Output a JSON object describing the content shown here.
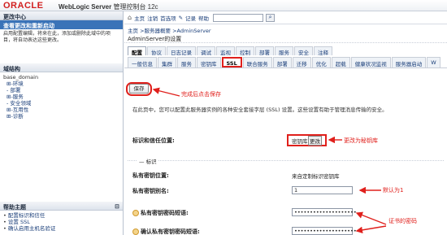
{
  "header": {
    "brand": "ORACLE",
    "product_bold": "WebLogic Server",
    "product_rest": " 管理控制台 12c"
  },
  "change_center": {
    "title": "更改中心",
    "link": "查看更改和重新启动",
    "description": "启用配置编辑，将来在此，添加或删除此域中的项目，将自动表达这些更改。"
  },
  "domain_structure": {
    "title": "域结构",
    "root": "base_domain",
    "items": [
      "⊞-环境",
      "- 部署",
      "⊞-服务",
      "- 安全领域",
      "⊞-互用性",
      "⊞-诊断"
    ]
  },
  "help_topics": {
    "title": "帮助主题",
    "items": [
      "配置标识和信任",
      "设置 SSL",
      "确认启用主机名验证"
    ]
  },
  "toolbar": {
    "items": [
      "主页",
      "注销",
      "首选项",
      "记录",
      "帮助"
    ]
  },
  "breadcrumb": "主页 >服务器概要 >AdminServer",
  "settings_title": "AdminServer的设置",
  "primary_tabs": [
    "配置",
    "协议",
    "日志记录",
    "调试",
    "监视",
    "控制",
    "部署",
    "服务",
    "安全",
    "注释"
  ],
  "secondary_tabs": [
    "一般信息",
    "集群",
    "服务",
    "密钥库",
    "SSL",
    "联合服务",
    "部署",
    "迁移",
    "优化",
    "超载",
    "健康状况监视",
    "服务器启动",
    "W"
  ],
  "save_label": "保存",
  "save_note": "完成后点击保存",
  "description": "在此页中，您可以配置此服务器实例的各种安全套接字层 (SSL) 设置。这些设置有助于管理消息传输的安全。",
  "keystore": {
    "label": "标识和信任位置:",
    "value": "密钥库",
    "change": "更改",
    "note": "更改为秘钥库"
  },
  "identity_section": "标识",
  "privkey_location": {
    "label": "私有密钥位置:",
    "value": "来自定制标识密钥库"
  },
  "privkey_alias": {
    "label": "私有密钥别名:",
    "value": "1",
    "note": "默认为1"
  },
  "passphrase": {
    "label": "私有密钥密码短语:",
    "value": "••••••••••••••••••••"
  },
  "confirm_passphrase": {
    "label": "确认私有密钥密码短语:",
    "value": "••••••••••••••••••••"
  },
  "password_note": "证书的密码",
  "colors": {
    "accent_red": "#e0201c",
    "link_blue": "#1b3f7a",
    "oracle_red": "#d21f1f"
  }
}
